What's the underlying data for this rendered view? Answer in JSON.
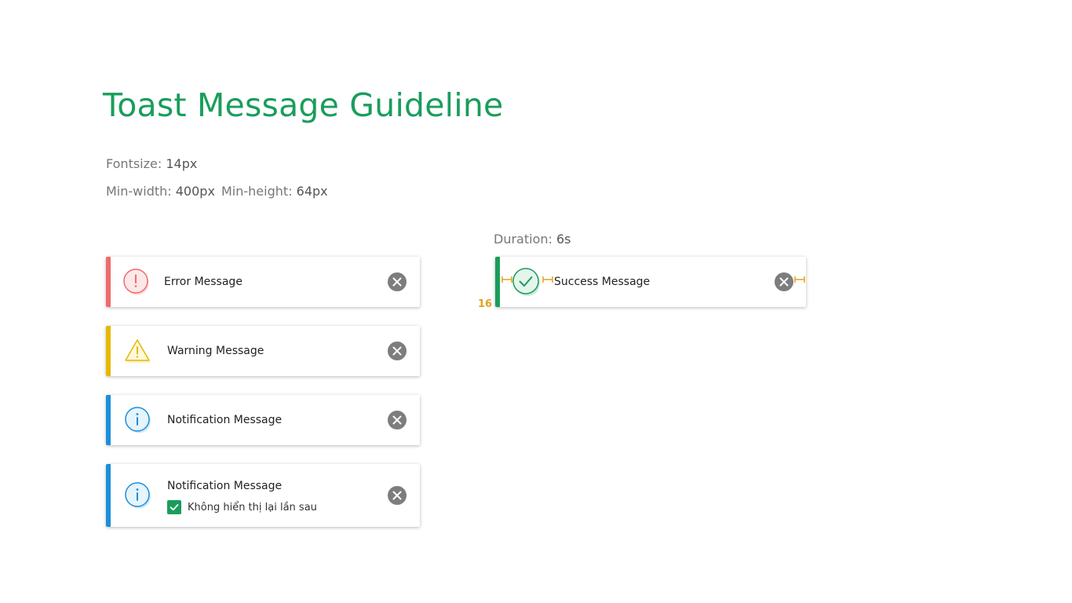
{
  "title": "Toast Message Guideline",
  "specs": {
    "fontsize_label": "Fontsize:",
    "fontsize_value": "14px",
    "minwidth_label": "Min-width:",
    "minwidth_value": "400px",
    "minheight_label": "Min-height:",
    "minheight_value": "64px",
    "duration_label": "Duration:",
    "duration_value": "6s"
  },
  "toasts": {
    "error": {
      "message": "Error Message",
      "icon": "exclamation-circle-icon",
      "color": "#ef6b6b"
    },
    "warning": {
      "message": "Warning Message",
      "icon": "warning-triangle-icon",
      "color": "#e6b800"
    },
    "notification": {
      "message": "Notification Message",
      "icon": "info-circle-icon",
      "color": "#1b8fd9"
    },
    "notification_checkbox": {
      "message": "Notification Message",
      "checkbox_label": "Không hiển thị lại lần sau",
      "checked": true,
      "icon": "info-circle-icon",
      "color": "#1b8fd9"
    },
    "success": {
      "message": "Success Message",
      "icon": "check-circle-icon",
      "color": "#1a9d5c"
    }
  },
  "annotation": {
    "padding": "16",
    "color": "#e3a21a"
  },
  "close_icon": "close-circle-icon",
  "accent": "#1a9d5c"
}
